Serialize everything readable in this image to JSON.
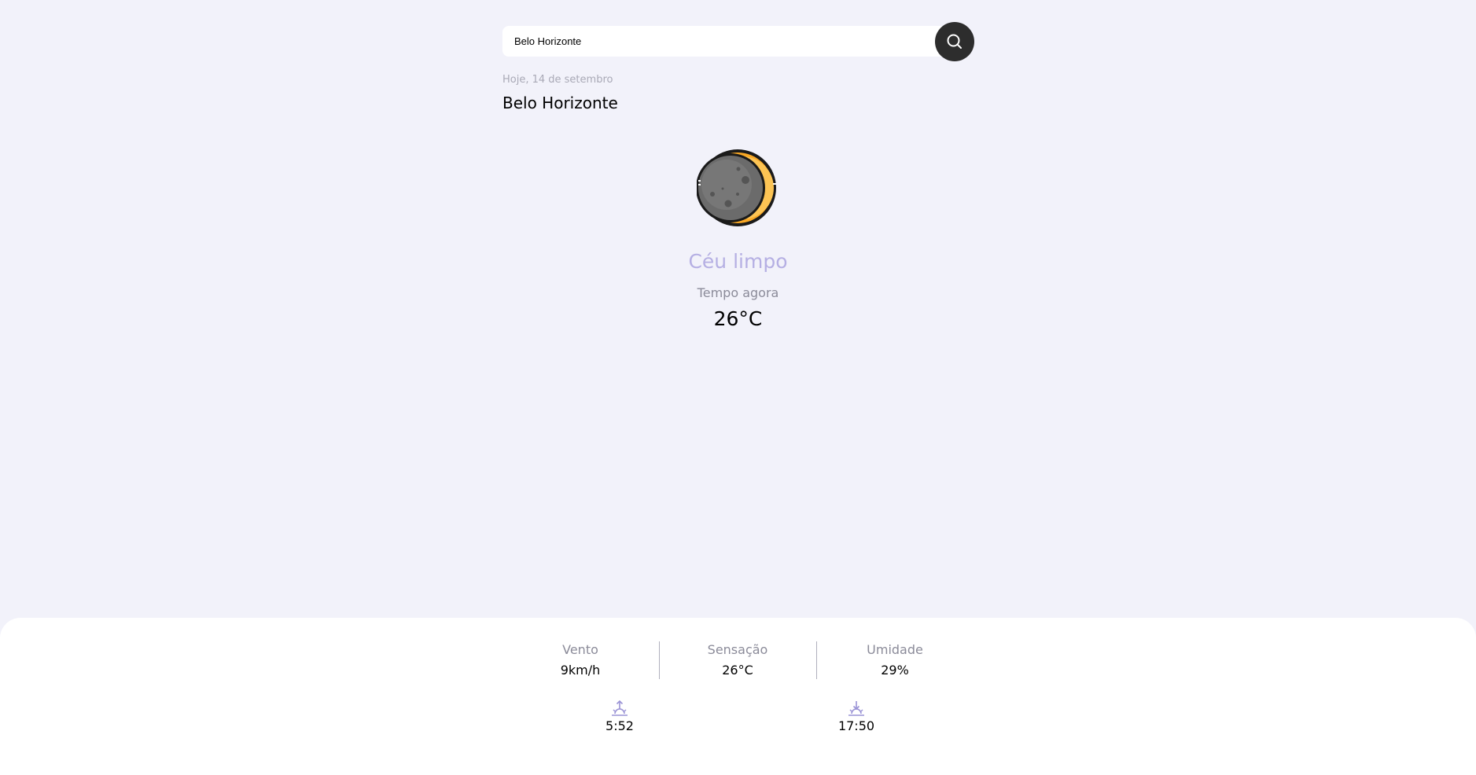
{
  "search": {
    "value": "Belo Horizonte",
    "button_icon": "search-icon"
  },
  "header": {
    "date": "Hoje, 14 de setembro",
    "city": "Belo Horizonte"
  },
  "current": {
    "icon": "moon-icon",
    "condition": "Céu limpo",
    "label": "Tempo agora",
    "temperature": "26°C"
  },
  "details": {
    "wind": {
      "label": "Vento",
      "value": "9km/h"
    },
    "feels_like": {
      "label": "Sensação",
      "value": "26°C"
    },
    "humidity": {
      "label": "Umidade",
      "value": "29%"
    }
  },
  "sun": {
    "sunrise": {
      "icon": "sunrise-icon",
      "time": "5:52"
    },
    "sunset": {
      "icon": "sunset-icon",
      "time": "17:50"
    }
  },
  "colors": {
    "background": "#f2f2fa",
    "accent": "#b5afe3",
    "button": "#2d2d2d",
    "moon_glow": "#f9a825"
  }
}
